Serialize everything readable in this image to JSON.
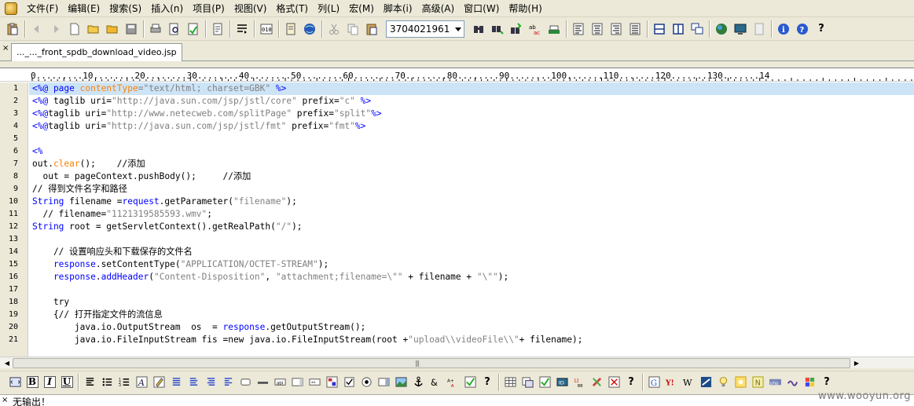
{
  "menu": [
    "文件(F)",
    "编辑(E)",
    "搜索(S)",
    "插入(n)",
    "项目(P)",
    "视图(V)",
    "格式(T)",
    "列(L)",
    "宏(M)",
    "脚本(i)",
    "高级(A)",
    "窗口(W)",
    "帮助(H)"
  ],
  "toolbar": {
    "combo_value": "3704021961\u0000",
    "help_label": "?"
  },
  "tab": {
    "close_label": "×",
    "title": "..._..._front_spdb_download_video.jsp"
  },
  "ruler": "0.........10........20........30........40........50........60........70........80........90........100.......110.......120.......130.......14",
  "lines": [
    {
      "n": "1",
      "hl": true,
      "t": [
        [
          "k",
          "<%@ page "
        ],
        [
          "o",
          "contentType"
        ],
        [
          "s",
          "=\"text/html; charset=GBK\" "
        ],
        [
          "k",
          "%>"
        ]
      ]
    },
    {
      "n": "2",
      "t": [
        [
          "k",
          "<%@ "
        ],
        [
          "t",
          "taglib uri="
        ],
        [
          "s",
          "\"http://java.sun.com/jsp/jstl/core\" "
        ],
        [
          "t",
          "prefix="
        ],
        [
          "s",
          "\"c\" "
        ],
        [
          "k",
          "%>"
        ]
      ]
    },
    {
      "n": "3",
      "t": [
        [
          "k",
          "<%@"
        ],
        [
          "t",
          "taglib uri="
        ],
        [
          "s",
          "\"http://www.netecweb.com/splitPage\" "
        ],
        [
          "t",
          "prefix="
        ],
        [
          "s",
          "\"split\""
        ],
        [
          "k",
          "%>"
        ]
      ]
    },
    {
      "n": "4",
      "t": [
        [
          "k",
          "<%@"
        ],
        [
          "t",
          "taglib uri="
        ],
        [
          "s",
          "\"http://java.sun.com/jsp/jstl/fmt\" "
        ],
        [
          "t",
          "prefix="
        ],
        [
          "s",
          "\"fmt\""
        ],
        [
          "k",
          "%>"
        ]
      ]
    },
    {
      "n": "5",
      "t": []
    },
    {
      "n": "6",
      "t": [
        [
          "k",
          "<%"
        ]
      ]
    },
    {
      "n": "7",
      "t": [
        [
          "t",
          "out."
        ],
        [
          "o",
          "clear"
        ],
        [
          "t",
          "();    //添加"
        ]
      ]
    },
    {
      "n": "8",
      "t": [
        [
          "t",
          "  out = pageContext.pushBody();     //添加"
        ]
      ]
    },
    {
      "n": "9",
      "t": [
        [
          "t",
          "// 得到文件名字和路径"
        ]
      ]
    },
    {
      "n": "10",
      "t": [
        [
          "k",
          "String "
        ],
        [
          "t",
          "filename ="
        ],
        [
          "k",
          "request"
        ],
        [
          "t",
          ".getParameter("
        ],
        [
          "s",
          "\"filename\""
        ],
        [
          "t",
          ");"
        ]
      ]
    },
    {
      "n": "11",
      "t": [
        [
          "t",
          "  // filename="
        ],
        [
          "s",
          "\"1121319585593.wmv\""
        ],
        [
          "t",
          ";"
        ]
      ]
    },
    {
      "n": "12",
      "t": [
        [
          "k",
          "String "
        ],
        [
          "t",
          "root = getServletContext().getRealPath("
        ],
        [
          "s",
          "\"/\""
        ],
        [
          "t",
          ");"
        ]
      ]
    },
    {
      "n": "13",
      "t": []
    },
    {
      "n": "14",
      "t": [
        [
          "t",
          "    // 设置响应头和下载保存的文件名"
        ]
      ]
    },
    {
      "n": "15",
      "t": [
        [
          "k",
          "    response"
        ],
        [
          "t",
          ".setContentType("
        ],
        [
          "s",
          "\"APPLICATION/OCTET-STREAM\""
        ],
        [
          "t",
          ");"
        ]
      ]
    },
    {
      "n": "16",
      "t": [
        [
          "k",
          "    response"
        ],
        [
          "t",
          "."
        ],
        [
          "k",
          "addHeader"
        ],
        [
          "t",
          "("
        ],
        [
          "s",
          "\"Content-Disposition\""
        ],
        [
          "t",
          ", "
        ],
        [
          "s",
          "\"attachment;filename=\\\"\" "
        ],
        [
          "t",
          "+ filename + "
        ],
        [
          "s",
          "\"\\\"\""
        ],
        [
          "t",
          ");"
        ]
      ]
    },
    {
      "n": "17",
      "t": []
    },
    {
      "n": "18",
      "t": [
        [
          "t",
          "    try"
        ]
      ]
    },
    {
      "n": "19",
      "t": [
        [
          "t",
          "    {// 打开指定文件的流信息"
        ]
      ]
    },
    {
      "n": "20",
      "t": [
        [
          "t",
          "        java.io.OutputStream  os  = "
        ],
        [
          "k",
          "response"
        ],
        [
          "t",
          ".getOutputStream();"
        ]
      ]
    },
    {
      "n": "21",
      "t": [
        [
          "t",
          "        java.io.FileInputStream fis =new java.io.FileInputStream(root +"
        ],
        [
          "s",
          "\"upload\\\\videoFile\\\\\""
        ],
        [
          "t",
          "+ filename);"
        ]
      ]
    }
  ],
  "toolbar2": {
    "bold": "B",
    "italic": "I",
    "underline": "U",
    "help_label": "?",
    "help_label2": "?",
    "help_label3": "?"
  },
  "output": {
    "close_label": "×",
    "message": "无输出！"
  },
  "watermark": "www.wooyun.org"
}
